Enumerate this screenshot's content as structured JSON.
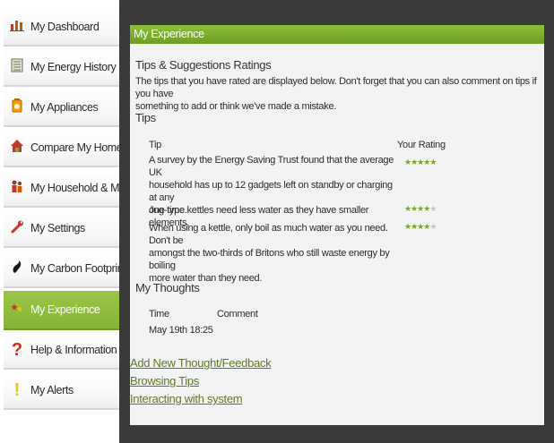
{
  "sidebar": {
    "items": [
      {
        "label": "My Dashboard",
        "icon": "bar-chart-icon"
      },
      {
        "label": "My Energy History",
        "icon": "ledger-icon"
      },
      {
        "label": "My Appliances",
        "icon": "appliance-icon"
      },
      {
        "label": "Compare My Home",
        "icon": "house-icon"
      },
      {
        "label": "My Household & Me",
        "icon": "people-icon"
      },
      {
        "label": "My Settings",
        "icon": "wrench-icon"
      },
      {
        "label": "My Carbon Footprint",
        "icon": "footprint-icon"
      },
      {
        "label": "My Experience",
        "icon": "stars-icon",
        "active": true
      },
      {
        "label": "Help & Information",
        "icon": "question-icon"
      },
      {
        "label": "My Alerts",
        "icon": "exclamation-icon"
      }
    ]
  },
  "panel": {
    "title": "My Experience",
    "ratings_heading": "Tips & Suggestions Ratings",
    "intro_line1": "The tips that you have rated are displayed below. Don't forget that you can also comment on tips if you have",
    "intro_line2": "something to add or think we've made a mistake.",
    "tips_heading": "Tips",
    "tips_table": {
      "col_tip": "Tip",
      "col_rating": "Your Rating",
      "rows": [
        {
          "lines": [
            "A survey by the Energy Saving Trust found that the average UK",
            "household has up to 12 gadgets left on standby or charging at any",
            "one time."
          ],
          "rating": 5
        },
        {
          "lines": [
            "Jug-type kettles need less water as they have smaller elements."
          ],
          "rating": 4
        },
        {
          "lines": [
            "When using a kettle, only boil as much water as you need. Don't be",
            "amongst the two-thirds of Britons who still waste energy by boiling",
            "more water than they need."
          ],
          "rating": 4
        }
      ]
    },
    "thoughts_heading": "My Thoughts",
    "thoughts_table": {
      "col_time": "Time",
      "col_comment": "Comment",
      "rows": [
        {
          "time": "May 19th 18:25",
          "comment": ""
        }
      ]
    },
    "links": [
      "Add New Thought/Feedback",
      "Browsing Tips",
      "Interacting with system"
    ]
  },
  "colors": {
    "accent_green": "#8dbf3b",
    "link_green": "#5e7a21",
    "dark_bg": "#3a3a3a",
    "star_green": "#7aa62c"
  }
}
